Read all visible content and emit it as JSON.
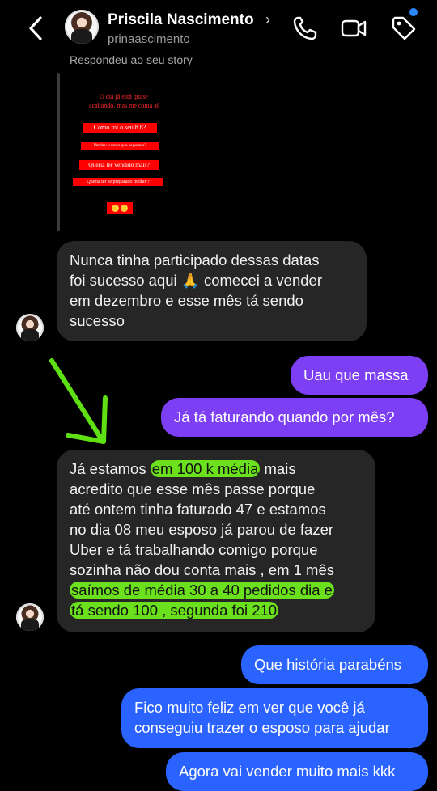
{
  "header": {
    "name": "Priscila Nascimento",
    "username": "prinaascimento",
    "chevron": "›",
    "icons": [
      "back-icon",
      "phone-icon",
      "video-icon",
      "tag-icon"
    ]
  },
  "story": {
    "reply_label": "Respondeu ao seu story",
    "title_line1": "O dia já está quase",
    "title_line2": "acabando, mas me conta aí",
    "box1": "Como foi o seu 8.8?",
    "box2": "Vendeu o tanto que esperava?",
    "box3": "Queria ter vendido mais?",
    "box4": "Queria ter se preparado melhor?"
  },
  "messages": {
    "m1": {
      "line1": "Nunca tinha participado dessas datas",
      "line2": "foi sucesso aqui 🙏 comecei a vender",
      "line3": "em dezembro e esse mês tá sendo",
      "line4": "sucesso"
    },
    "m2": "Uau que massa",
    "m3": "Já tá faturando quando por mês?",
    "m4": {
      "line1a": "Já estamos ",
      "line1b": "em 100 k média",
      "line1c": " mais",
      "line2": "acredito que esse mês passe porque",
      "line3": "até ontem tinha faturado 47 e estamos",
      "line4": "no dia 08 meu esposo já parou de fazer",
      "line5": "Uber e tá trabalhando comigo porque",
      "line6": "sozinha não dou conta mais , em 1 mês",
      "line7": "saímos de média 30 a 40 pedidos dia e",
      "line8": "tá sendo 100 , segunda foi 210"
    },
    "m5": "Que história parabéns",
    "m6": {
      "line1": "Fico muito feliz em ver que você já",
      "line2": "conseguiu trazer o esposo para ajudar"
    },
    "m7": "Agora vai vender muito mais kkk"
  },
  "colors": {
    "incoming": "#262626",
    "outgoing_purple": "#7d3ff3",
    "outgoing_blue": "#2a63ff",
    "highlight": "#6be01d"
  }
}
